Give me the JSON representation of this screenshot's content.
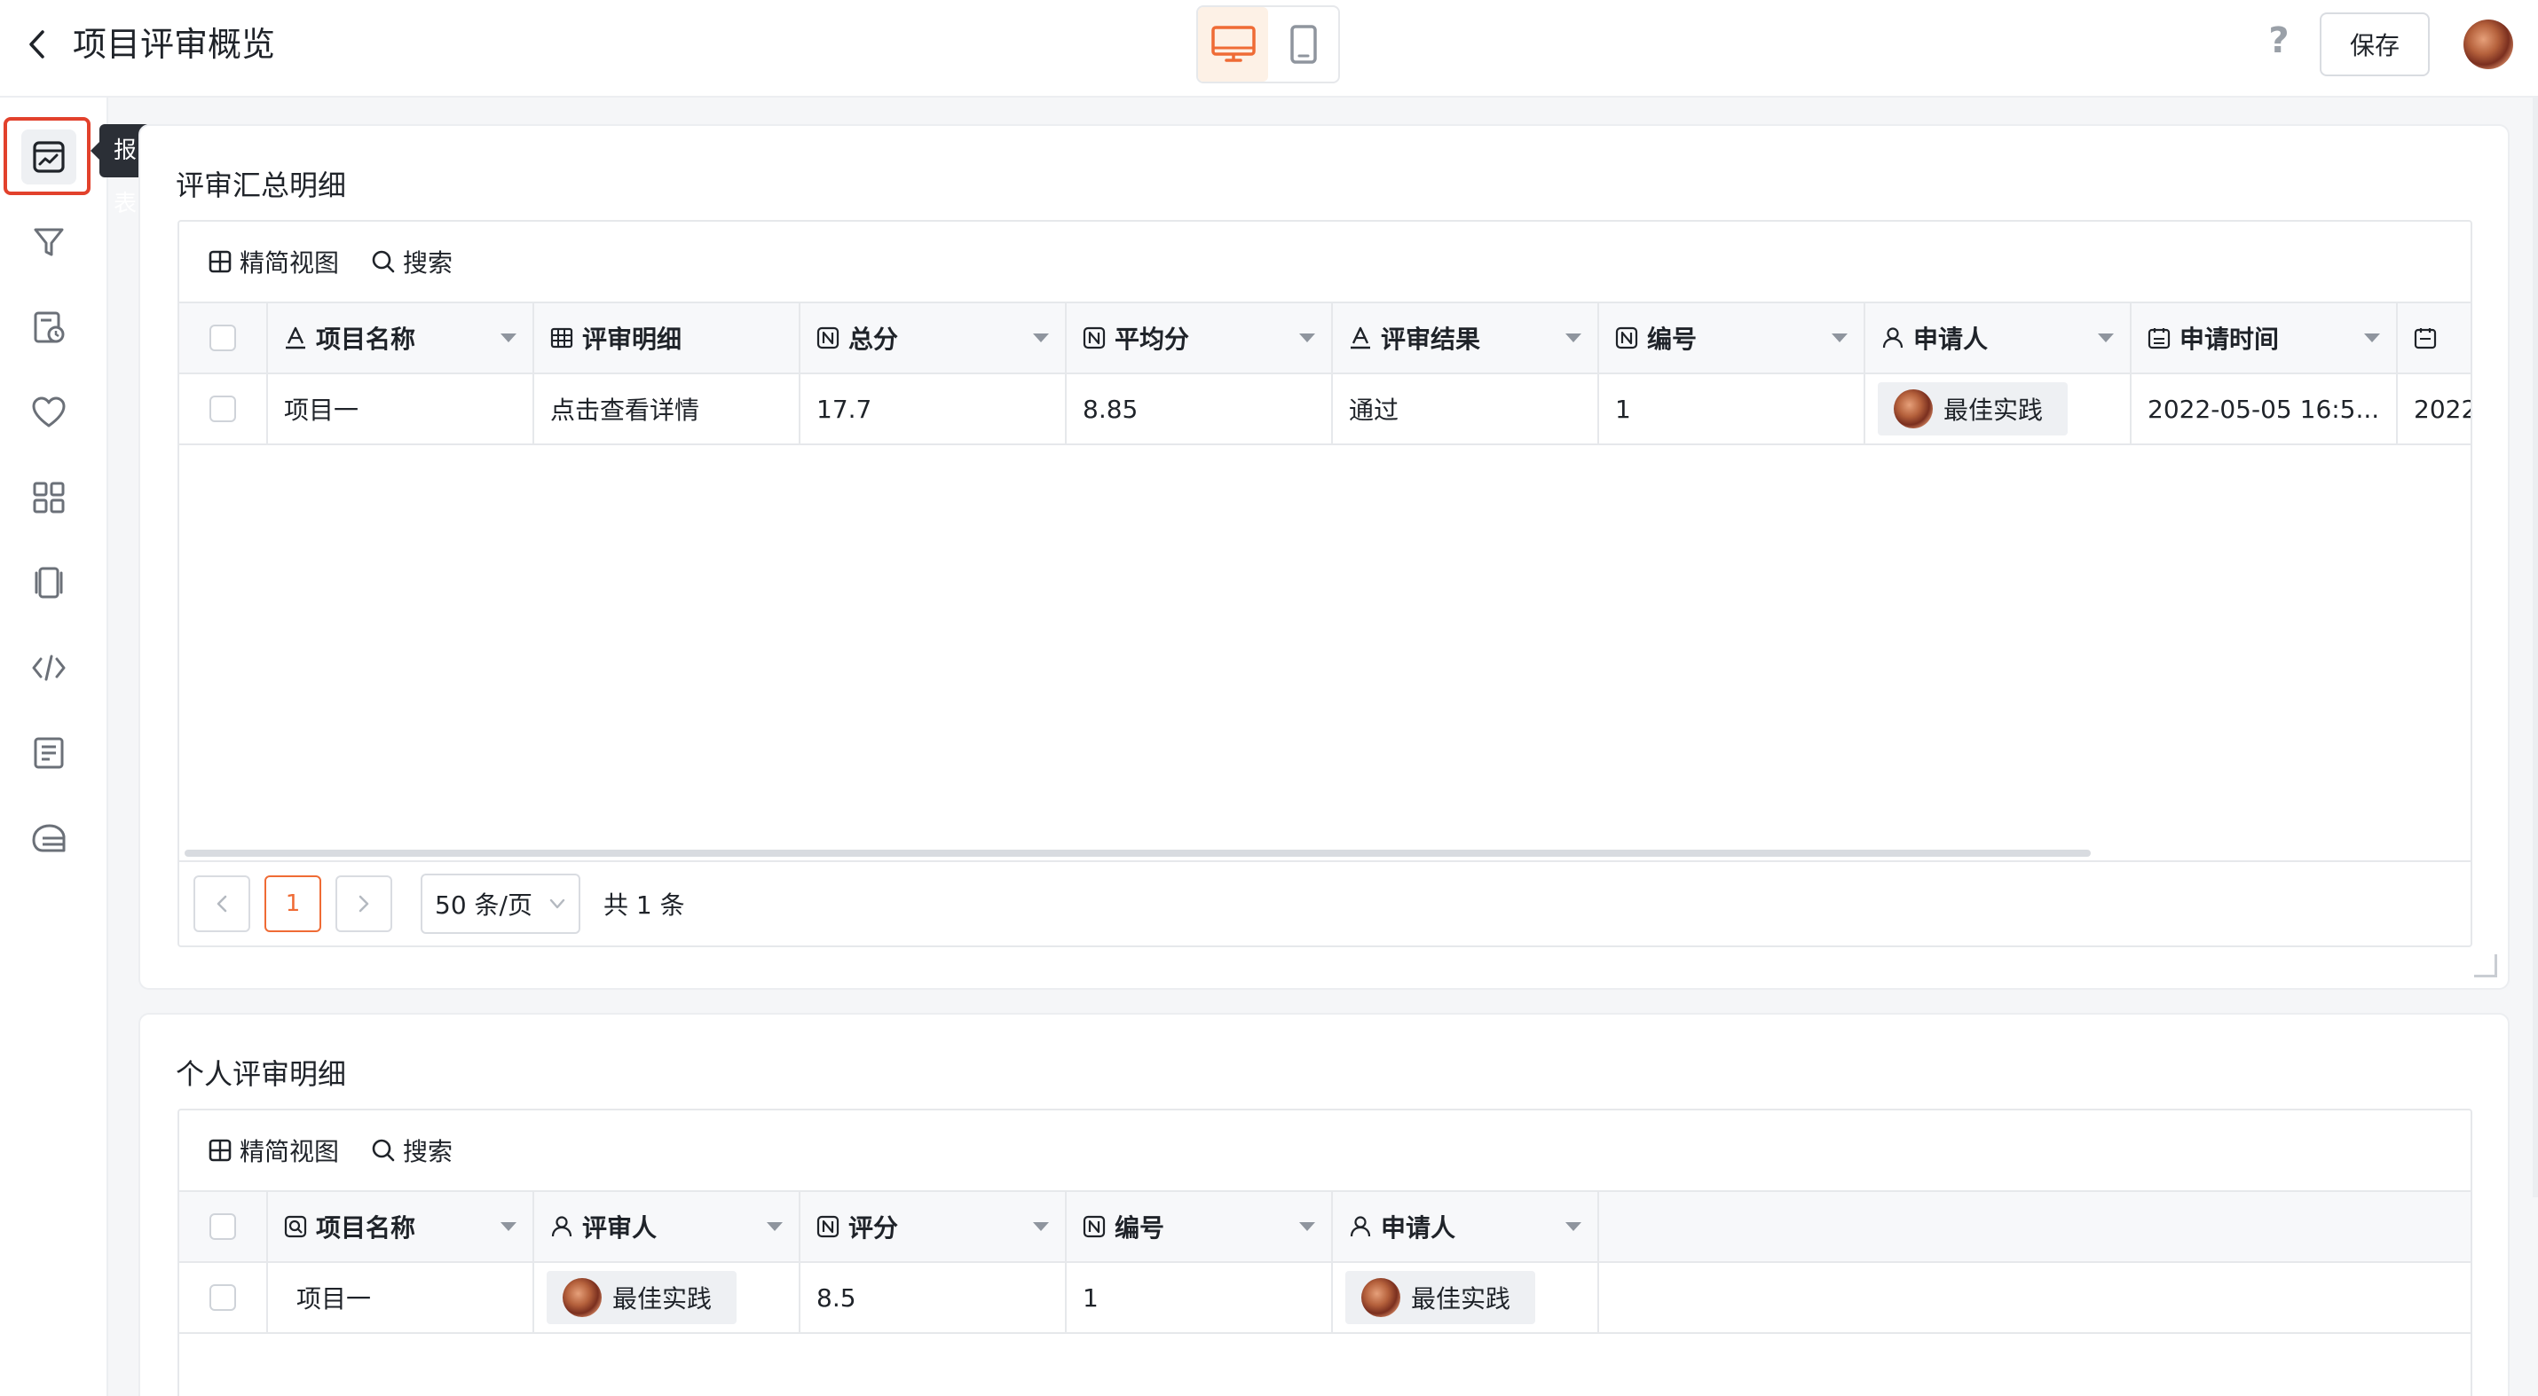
{
  "header": {
    "title": "项目评审概览",
    "save_label": "保存",
    "help_label": "?"
  },
  "siderail": {
    "tooltip": "报表",
    "items": [
      {
        "icon": "chart-icon",
        "active": true
      },
      {
        "icon": "filter-icon"
      },
      {
        "icon": "calendar-clock-icon"
      },
      {
        "icon": "heart-icon"
      },
      {
        "icon": "grid-icon"
      },
      {
        "icon": "carousel-icon"
      },
      {
        "icon": "code-icon"
      },
      {
        "icon": "document-icon"
      },
      {
        "icon": "inbox-icon"
      }
    ]
  },
  "summary": {
    "title": "评审汇总明细",
    "toolbar": {
      "compact_view": "精简视图",
      "search": "搜索"
    },
    "columns": [
      {
        "label": "项目名称",
        "icon": "text-field-icon"
      },
      {
        "label": "评审明细",
        "icon": "table-field-icon"
      },
      {
        "label": "总分",
        "icon": "number-field-icon"
      },
      {
        "label": "平均分",
        "icon": "number-field-icon"
      },
      {
        "label": "评审结果",
        "icon": "text-field-icon"
      },
      {
        "label": "编号",
        "icon": "number-field-icon"
      },
      {
        "label": "申请人",
        "icon": "person-field-icon"
      },
      {
        "label": "申请时间",
        "icon": "date-field-icon"
      },
      {
        "label": "",
        "icon": "date-field-icon"
      }
    ],
    "rows": [
      {
        "project": "项目一",
        "detail": "点击查看详情",
        "total": "17.7",
        "avg": "8.85",
        "result": "通过",
        "number": "1",
        "applicant": "最佳实践",
        "apply_time": "2022-05-05 16:5...",
        "extra": "2022"
      }
    ],
    "pager": {
      "prev": "<",
      "current": "1",
      "next": ">",
      "page_size": "50 条/页",
      "total": "共 1 条"
    }
  },
  "personal": {
    "title": "个人评审明细",
    "toolbar": {
      "compact_view": "精简视图",
      "search": "搜索"
    },
    "columns": [
      {
        "label": "项目名称",
        "icon": "lookup-field-icon"
      },
      {
        "label": "评审人",
        "icon": "person-field-icon"
      },
      {
        "label": "评分",
        "icon": "number-field-icon"
      },
      {
        "label": "编号",
        "icon": "number-field-icon"
      },
      {
        "label": "申请人",
        "icon": "person-field-icon"
      }
    ],
    "rows": [
      {
        "project": "项目一",
        "reviewer": "最佳实践",
        "score": "8.5",
        "number": "1",
        "applicant": "最佳实践"
      }
    ]
  },
  "colors": {
    "accent": "#ef6b35",
    "highlight": "#e2412c",
    "tooltip_bg": "#2b2f36"
  }
}
